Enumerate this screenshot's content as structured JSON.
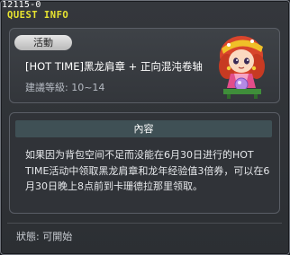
{
  "window": {
    "quest_id": "12115-0",
    "title": "QUEST INFO"
  },
  "summary": {
    "badge": "活動",
    "quest_name": "[HOT TIME]黑龙肩章 + 正向混沌卷轴",
    "level_requirement": "建議等級: 10~14"
  },
  "content": {
    "header": "內容",
    "text": "如果因为背包空间不足而没能在6月30日进行的HOT TIME活动中领取黑龙肩章和龙年经验值3倍券，可以在6月30日晚上8点前到卡珊德拉那里领取。"
  },
  "status": {
    "text": "狀態: 可開始"
  },
  "colors": {
    "title": "#e8e430",
    "badge_bg": "#cfcfcf",
    "content_header_bg": "#3f5055"
  },
  "icons": {
    "npc": "npc-cassandra-portrait"
  }
}
